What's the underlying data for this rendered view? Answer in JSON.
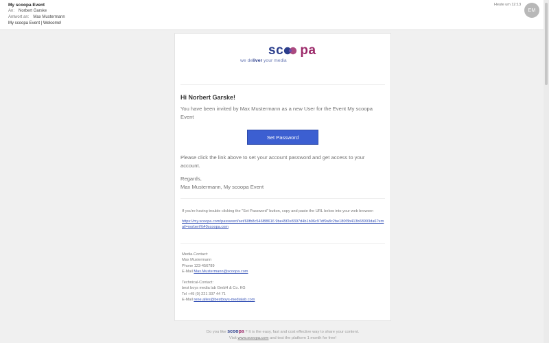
{
  "header": {
    "subject": "My scoopa Event",
    "to_label": "An:",
    "to": "Norbert Garske",
    "reply_label": "Antwort an:",
    "reply_to": "Max Mustermann",
    "preview": "My scoopa Event | Welcome!",
    "time": "Heute um 12:13",
    "avatar_initials": "EM"
  },
  "logo": {
    "text_left": "sc",
    "text_dots": "oo",
    "text_right": "pa",
    "tagline_pre": "we de",
    "tagline_bold": "liver",
    "tagline_post": " your media",
    "colors": {
      "blue": "#2b3e8c",
      "magenta": "#9c2a6a"
    }
  },
  "email": {
    "greeting": "Hi Norbert Garske!",
    "intro": "You have been invited by Max Mustermann as a new User for the Event My scoopa Event",
    "button_label": "Set Password",
    "instructions": "Please click the link above to set your account password and get access to your account.",
    "regards": "Regards,",
    "signature": "Max Mustermann, My scoopa Event",
    "trouble_text": "If you're having trouble clicking the \"Set Password\" button, copy and paste the URL below into your web browser:",
    "url": "https://my.scoopa.com/password/set/60fb8c546f88616 9be45f2e8397d4b1b06c97df9a8c2be180f3b413b68993da6?email=norbert%40scoopa.com"
  },
  "contacts": {
    "media": {
      "title": "Media-Contact:",
      "name": "Max Mustermann",
      "phone": "Phone 123-456789",
      "email_label": "E-Mail",
      "email": "Max.Mustermann@scoopa.com"
    },
    "technical": {
      "title": "Technical-Contact:",
      "company": "best boys media lab GmbH & Co. KG",
      "phone": "Tel +49 (0) 221 337 44 71",
      "email_label": "E-Mail",
      "email": "rene.alles@bestboys-medialab.com"
    }
  },
  "footer": {
    "line1_pre": "Do you like",
    "line1_post": "? It is the easy, fast and cost effective way to share your content.",
    "line2_pre": "Visit",
    "link": "www.scoopa.com",
    "line2_post": "and test the platform 1 month for free!"
  }
}
